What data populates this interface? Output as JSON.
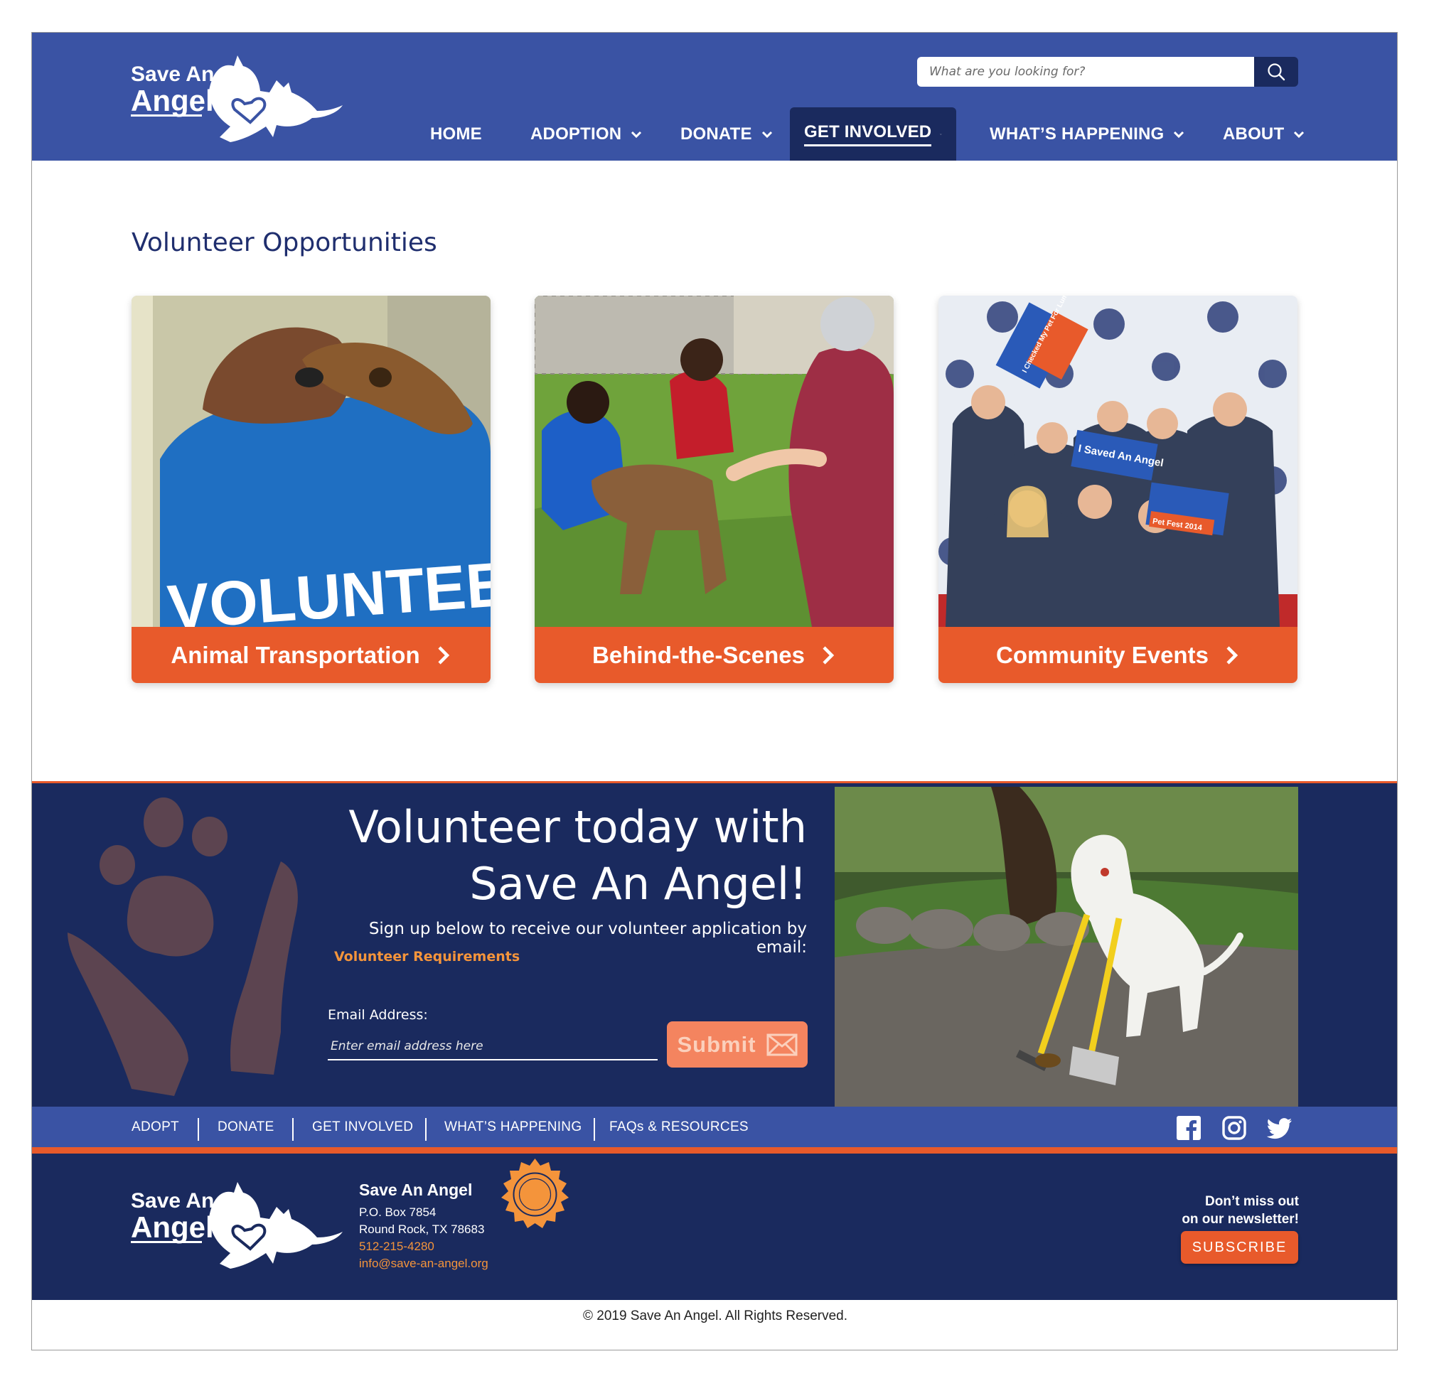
{
  "header": {
    "logo_text_line1": "Save An",
    "logo_text_line2": "Angel",
    "search_placeholder": "What are you looking for?",
    "nav": [
      {
        "label": "HOME"
      },
      {
        "label": "ADOPTION"
      },
      {
        "label": "DONATE"
      },
      {
        "label": "GET INVOLVED"
      },
      {
        "label": "WHAT’S HAPPENING"
      },
      {
        "label": "ABOUT"
      }
    ]
  },
  "main": {
    "title": "Volunteer Opportunities",
    "cards": [
      {
        "label": "Animal Transportation",
        "photo_text": "VOLUNTEER"
      },
      {
        "label": "Behind-the-Scenes"
      },
      {
        "label": "Community Events",
        "photo_signs": [
          "I Saved An Angel",
          "Pet Fest 2014",
          "I Checked My Pet For Lumps"
        ]
      }
    ]
  },
  "band": {
    "title_line1": "Volunteer today with",
    "title_line2": "Save An Angel!",
    "subtitle": "Sign up below to receive our volunteer application by email:",
    "link": "Volunteer Requirements",
    "email_label": "Email Address:",
    "email_placeholder": "Enter email address here",
    "submit_label": "Submit"
  },
  "footer_nav": {
    "items": [
      "ADOPT",
      "DONATE",
      "GET INVOLVED",
      "WHAT’S HAPPENING",
      "FAQs & RESOURCES"
    ],
    "social": [
      "facebook-icon",
      "instagram-icon",
      "twitter-icon"
    ]
  },
  "footer": {
    "org": "Save An Angel",
    "address1": "P.O. Box 7854",
    "address2": "Round Rock, TX 78683",
    "phone": "512-215-4280",
    "email": "info@save-an-angel.org",
    "newsletter_line1": "Don’t miss out",
    "newsletter_line2": "on our newsletter!",
    "subscribe_label": "SUBSCRIBE",
    "copyright": "© 2019 Save An Angel. All Rights Reserved."
  },
  "colors": {
    "header_blue": "#3a53a4",
    "navy": "#1a2a5e",
    "orange": "#e85a2b",
    "link_orange": "#f4943b"
  }
}
